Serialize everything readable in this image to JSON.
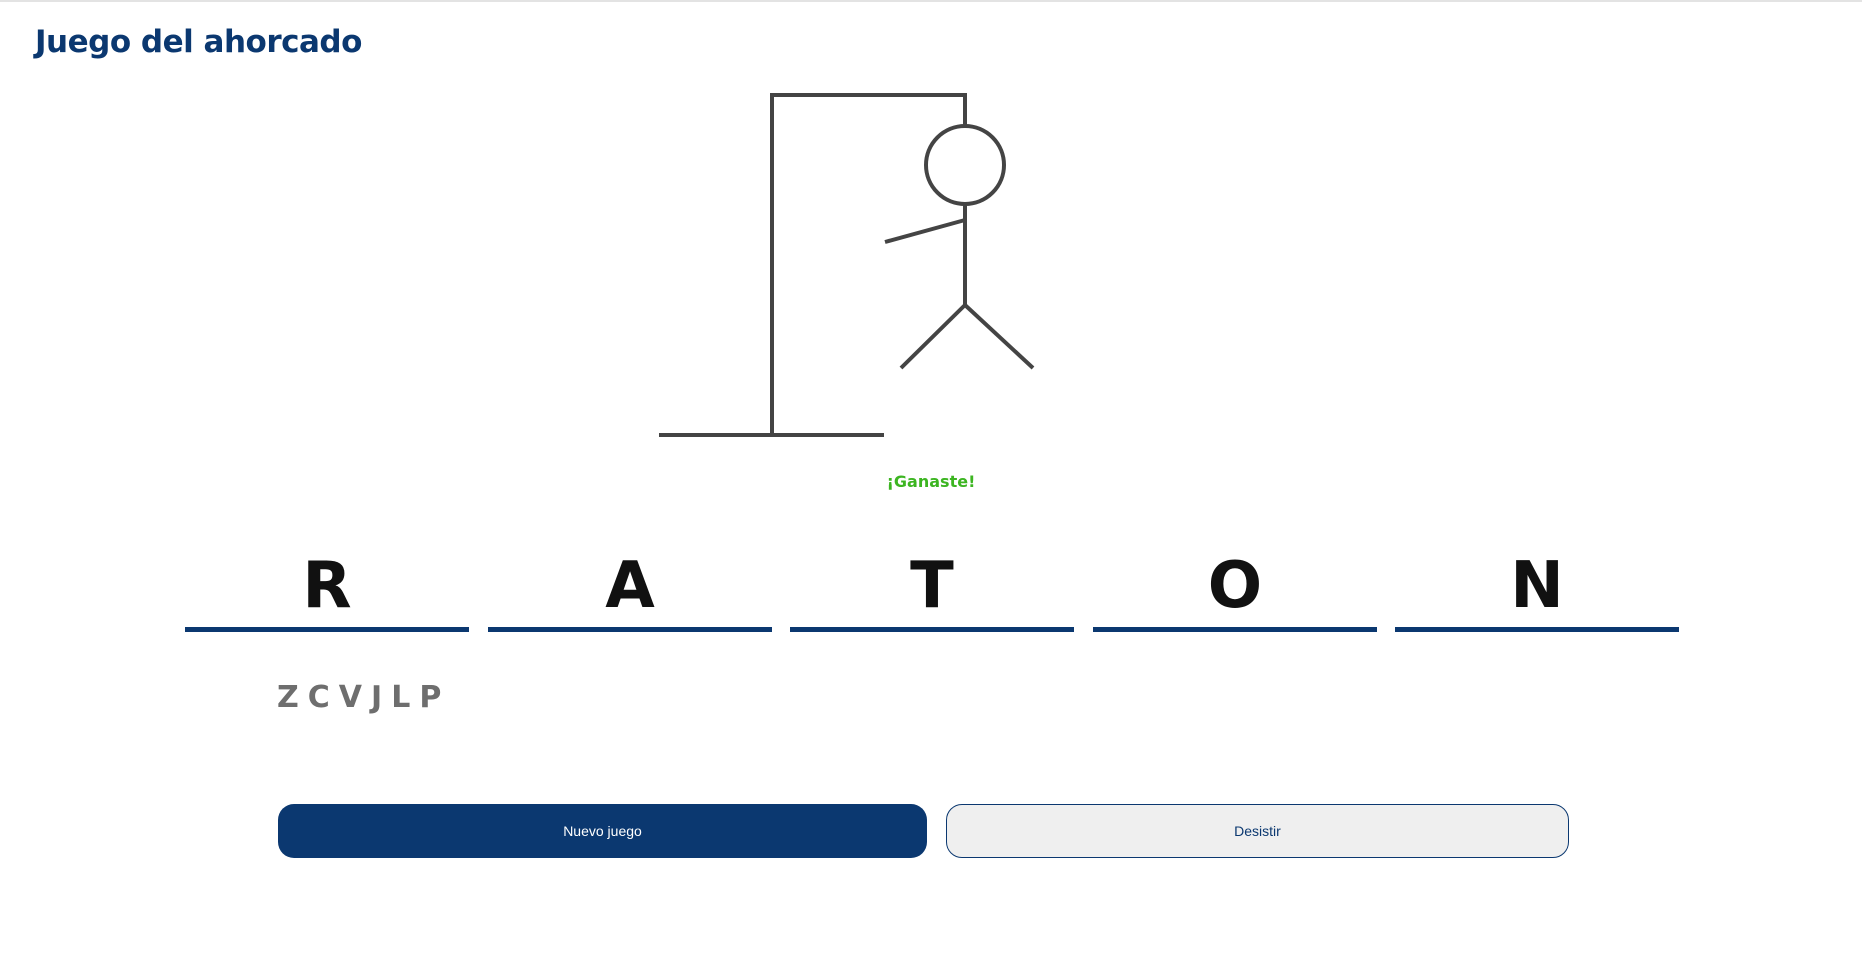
{
  "header": {
    "title": "Juego del ahorcado"
  },
  "hangman": {
    "icon": "hangman-drawing",
    "parts_visible": [
      "base",
      "pole",
      "beam",
      "rope",
      "head",
      "body",
      "left-arm",
      "left-leg",
      "right-leg"
    ],
    "stroke_color": "#444444"
  },
  "status": {
    "message": "¡Ganaste!",
    "color": "#3cb521"
  },
  "word": {
    "letters": [
      "R",
      "A",
      "T",
      "O",
      "N"
    ]
  },
  "wrong_letters": [
    "Z",
    "C",
    "V",
    "J",
    "L",
    "P"
  ],
  "buttons": {
    "new_game": "Nuevo juego",
    "give_up": "Desistir"
  },
  "colors": {
    "primary": "#0b3870",
    "success": "#3cb521",
    "muted": "#6e6e6e"
  }
}
